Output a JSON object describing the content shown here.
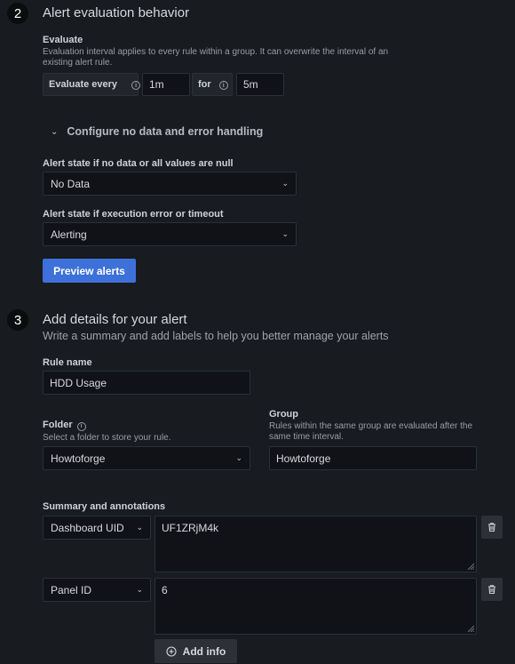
{
  "section2": {
    "number": "2",
    "title": "Alert evaluation behavior",
    "evaluate_label": "Evaluate",
    "evaluate_desc": "Evaluation interval applies to every rule within a group. It can overwrite the interval of an existing alert rule.",
    "evaluate_every_label": "Evaluate every",
    "evaluate_every_value": "1m",
    "for_label": "for",
    "for_value": "5m",
    "toggle_label": "Configure no data and error handling",
    "no_data_label": "Alert state if no data or all values are null",
    "no_data_value": "No Data",
    "error_label": "Alert state if execution error or timeout",
    "error_value": "Alerting",
    "preview_button": "Preview alerts"
  },
  "section3": {
    "number": "3",
    "title": "Add details for your alert",
    "subtitle": "Write a summary and add labels to help you better manage your alerts",
    "rule_name_label": "Rule name",
    "rule_name_value": "HDD Usage",
    "folder_label": "Folder",
    "folder_desc": "Select a folder to store your rule.",
    "folder_value": "Howtoforge",
    "group_label": "Group",
    "group_desc": "Rules within the same group are evaluated after the same time interval.",
    "group_value": "Howtoforge",
    "annotations_label": "Summary and annotations",
    "annotations": [
      {
        "key": "Dashboard UID",
        "value": "UF1ZRjM4k"
      },
      {
        "key": "Panel ID",
        "value": "6"
      }
    ],
    "add_info_button": "Add info"
  },
  "colors": {
    "background": "#181b1f",
    "primary": "#3d71d9",
    "input_bg": "#111217",
    "border": "#2c3039"
  }
}
